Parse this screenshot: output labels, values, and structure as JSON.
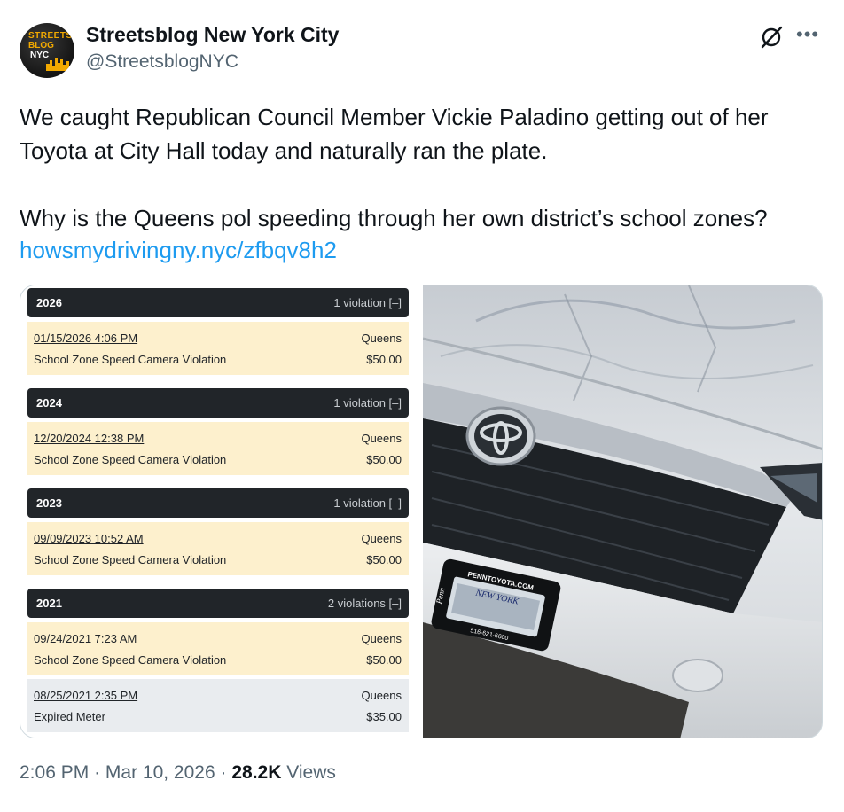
{
  "account": {
    "name": "Streetsblog New York City",
    "handle": "@StreetsblogNYC",
    "avatar_text": [
      "STREETS",
      "BLOG",
      "NYC"
    ]
  },
  "tweet": {
    "text": "We caught Republican Council Member Vickie Paladino getting out of her\nToyota at City Hall today and naturally ran the plate.\n\nWhy is the Queens pol speeding through her own district’s school zones?",
    "link": "howsmydrivingny.nyc/zfbqv8h2"
  },
  "violations": {
    "groups": [
      {
        "year": "2026",
        "count": "1 violation [–]",
        "items": [
          {
            "date": "01/15/2026 4:06 PM",
            "borough": "Queens",
            "desc": "School Zone Speed Camera Violation",
            "amount": "$50.00"
          }
        ]
      },
      {
        "year": "2024",
        "count": "1 violation [–]",
        "items": [
          {
            "date": "12/20/2024 12:38 PM",
            "borough": "Queens",
            "desc": "School Zone Speed Camera Violation",
            "amount": "$50.00"
          }
        ]
      },
      {
        "year": "2023",
        "count": "1 violation [–]",
        "items": [
          {
            "date": "09/09/2023 10:52 AM",
            "borough": "Queens",
            "desc": "School Zone Speed Camera Violation",
            "amount": "$50.00"
          }
        ]
      },
      {
        "year": "2021",
        "count": "2 violations [–]",
        "items": [
          {
            "date": "09/24/2021 7:23 AM",
            "borough": "Queens",
            "desc": "School Zone Speed Camera Violation",
            "amount": "$50.00"
          },
          {
            "date": "08/25/2021 2:35 PM",
            "borough": "Queens",
            "desc": "Expired Meter",
            "amount": "$35.00"
          }
        ]
      }
    ]
  },
  "photo": {
    "plate_frame_top": "PENNTOYOTA.COM",
    "plate_state": "NEW YORK",
    "plate_frame_bottom": "516-621-6600",
    "plate_frame_side": "Penn",
    "colors": {
      "car_body": "#d9dcdf",
      "grille": "#1e2226",
      "ground": "#3b3a38"
    }
  },
  "meta": {
    "time": "2:06 PM",
    "separator": "·",
    "date": "Mar 10, 2026",
    "views_count": "28.2K",
    "views_label": "Views"
  },
  "icons": {
    "grok": "grok-icon",
    "more": "more-icon"
  }
}
